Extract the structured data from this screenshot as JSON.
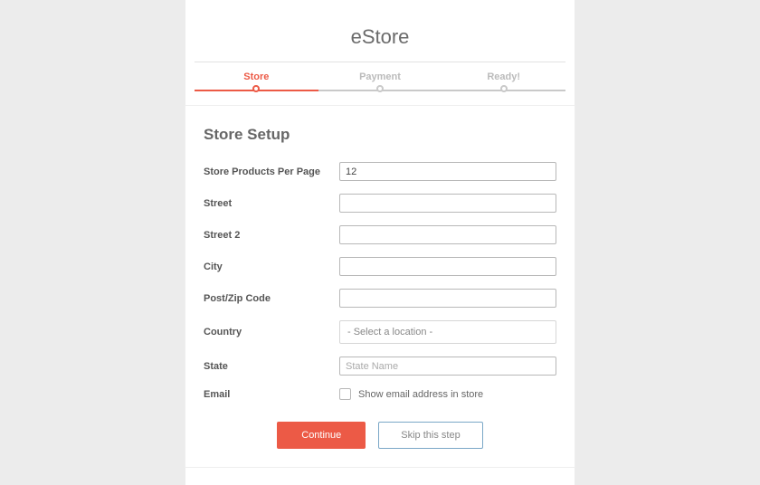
{
  "header": {
    "title": "eStore"
  },
  "steps": [
    {
      "label": "Store",
      "active": true
    },
    {
      "label": "Payment",
      "active": false
    },
    {
      "label": "Ready!",
      "active": false
    }
  ],
  "card": {
    "title": "Store Setup"
  },
  "form": {
    "products_per_page": {
      "label": "Store Products Per Page",
      "value": "12"
    },
    "street": {
      "label": "Street",
      "value": ""
    },
    "street2": {
      "label": "Street 2",
      "value": ""
    },
    "city": {
      "label": "City",
      "value": ""
    },
    "postcode": {
      "label": "Post/Zip Code",
      "value": ""
    },
    "country": {
      "label": "Country",
      "placeholder": "- Select a location -"
    },
    "state": {
      "label": "State",
      "placeholder": "State Name",
      "value": ""
    },
    "email": {
      "label": "Email",
      "checkbox_label": "Show email address in store"
    }
  },
  "actions": {
    "continue": "Continue",
    "skip": "Skip this step"
  }
}
